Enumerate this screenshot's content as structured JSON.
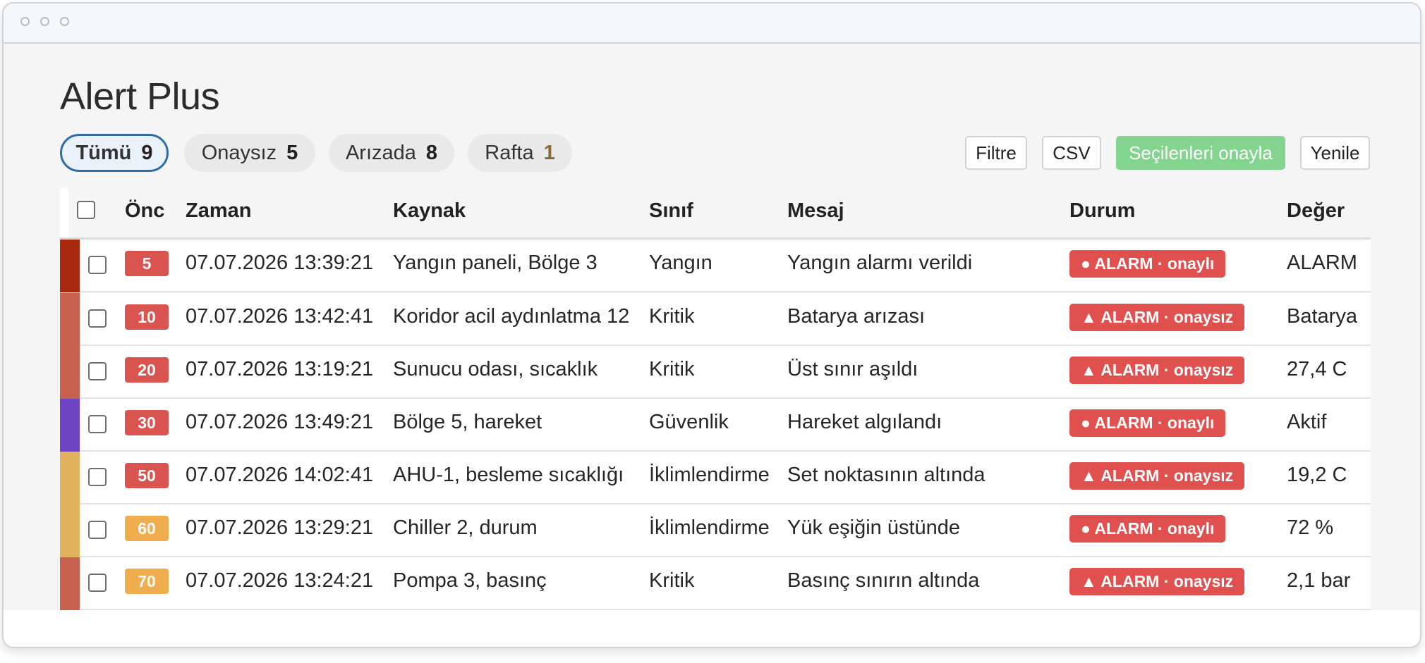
{
  "app": {
    "title": "Alert Plus"
  },
  "tabs": [
    {
      "label": "Tümü",
      "count": "9"
    },
    {
      "label": "Onaysız",
      "count": "5"
    },
    {
      "label": "Arızada",
      "count": "8"
    },
    {
      "label": "Rafta",
      "count": "1"
    }
  ],
  "toolbar": {
    "filter_label": "Filtre",
    "csv_label": "CSV",
    "approve_label": "Seçilenleri onayla",
    "refresh_label": "Yenile"
  },
  "table": {
    "columns": [
      "Önc",
      "Zaman",
      "Kaynak",
      "Sınıf",
      "Mesaj",
      "Durum",
      "Değer"
    ],
    "rows": [
      {
        "priority": "5",
        "time": "07.07.2026 13:39:21",
        "source": "Yangın paneli, Bölge 3",
        "class": "Yangın",
        "message": "Yangın alarmı verildi",
        "status": "● ALARM · onaylı",
        "value": "ALARM",
        "bar_color": "#a8290f",
        "prio_color": "#d9534f"
      },
      {
        "priority": "10",
        "time": "07.07.2026 13:42:41",
        "source": "Koridor acil aydınlatma 12",
        "class": "Kritik",
        "message": "Batarya arızası",
        "status": "▲ ALARM · onaysız",
        "value": "Batarya",
        "bar_color": "#c8614f",
        "prio_color": "#d9534f"
      },
      {
        "priority": "20",
        "time": "07.07.2026 13:19:21",
        "source": "Sunucu odası, sıcaklık",
        "class": "Kritik",
        "message": "Üst sınır aşıldı",
        "status": "▲ ALARM · onaysız",
        "value": "27,4 C",
        "bar_color": "#c8614f",
        "prio_color": "#d9534f"
      },
      {
        "priority": "30",
        "time": "07.07.2026 13:49:21",
        "source": "Bölge 5, hareket",
        "class": "Güvenlik",
        "message": "Hareket algılandı",
        "status": "● ALARM · onaylı",
        "value": "Aktif",
        "bar_color": "#6f44c4",
        "prio_color": "#d9534f"
      },
      {
        "priority": "50",
        "time": "07.07.2026 14:02:41",
        "source": "AHU-1, besleme sıcaklığı",
        "class": "İklimlendirme",
        "message": "Set noktasının altında",
        "status": "▲ ALARM · onaysız",
        "value": "19,2 C",
        "bar_color": "#e3b25e",
        "prio_color": "#d9534f"
      },
      {
        "priority": "60",
        "time": "07.07.2026 13:29:21",
        "source": "Chiller 2, durum",
        "class": "İklimlendirme",
        "message": "Yük eşiğin üstünde",
        "status": "● ALARM · onaylı",
        "value": "72 %",
        "bar_color": "#e3b25e",
        "prio_color": "#f0ad4e"
      },
      {
        "priority": "70",
        "time": "07.07.2026 13:24:21",
        "source": "Pompa 3, basınç",
        "class": "Kritik",
        "message": "Basınç sınırın altında",
        "status": "▲ ALARM · onaysız",
        "value": "2,1 bar",
        "bar_color": "#c8614f",
        "prio_color": "#f0ad4e"
      }
    ]
  },
  "colors": {
    "tab_active_border": "#2e6ca8",
    "status_alarm": "#e0504f",
    "approve_button": "#83d48f"
  }
}
